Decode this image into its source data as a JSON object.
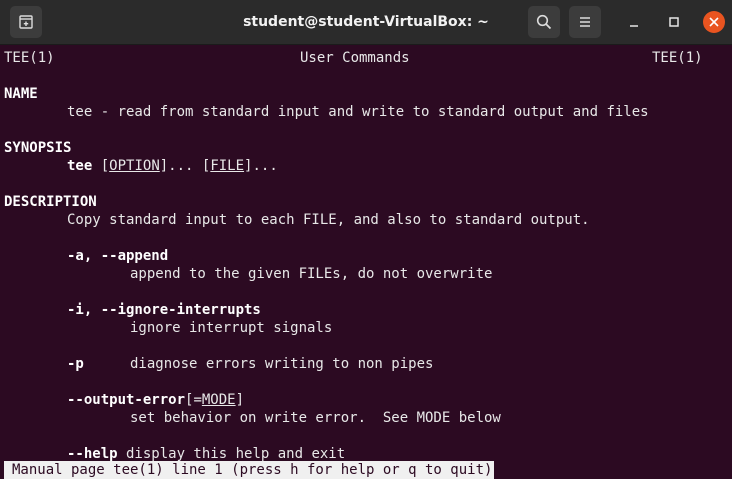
{
  "window": {
    "title": "student@student-VirtualBox: ~"
  },
  "icons": {
    "new_tab": "new-tab-icon",
    "search": "search-icon",
    "menu": "hamburger-menu-icon",
    "minimize": "minimize-icon",
    "maximize": "maximize-icon",
    "close": "close-icon"
  },
  "colors": {
    "terminal_bg": "#2c0a22",
    "titlebar_bg": "#2b2b2b",
    "close_accent": "#e95420"
  },
  "man": {
    "header_left": "TEE(1)",
    "header_center": "User Commands",
    "header_right": "TEE(1)",
    "name_heading": "NAME",
    "name_text": "tee - read from standard input and write to standard output and files",
    "synopsis_heading": "SYNOPSIS",
    "synopsis_cmd": "tee",
    "synopsis_bracket_open": "[",
    "synopsis_option": "OPTION",
    "synopsis_bracket_close_dots": "]... [",
    "synopsis_file": "FILE",
    "synopsis_tail": "]...",
    "description_heading": "DESCRIPTION",
    "description_text": "Copy standard input to each FILE, and also to standard output.",
    "opt_append": "-a, --append",
    "opt_append_desc": "append to the given FILEs, do not overwrite",
    "opt_ignore": "-i, --ignore-interrupts",
    "opt_ignore_desc": "ignore interrupt signals",
    "opt_p": "-p",
    "opt_p_desc": "diagnose errors writing to non pipes",
    "opt_output_error": "--output-error",
    "opt_output_error_bracket": "[=",
    "opt_output_error_mode": "MODE",
    "opt_output_error_close": "]",
    "opt_output_error_desc": "set behavior on write error.  See MODE below",
    "opt_help": "--help",
    "opt_help_desc": " display this help and exit"
  },
  "status_bar": {
    "text": "Manual page tee(1) line 1 (press h for help or q to quit)"
  }
}
